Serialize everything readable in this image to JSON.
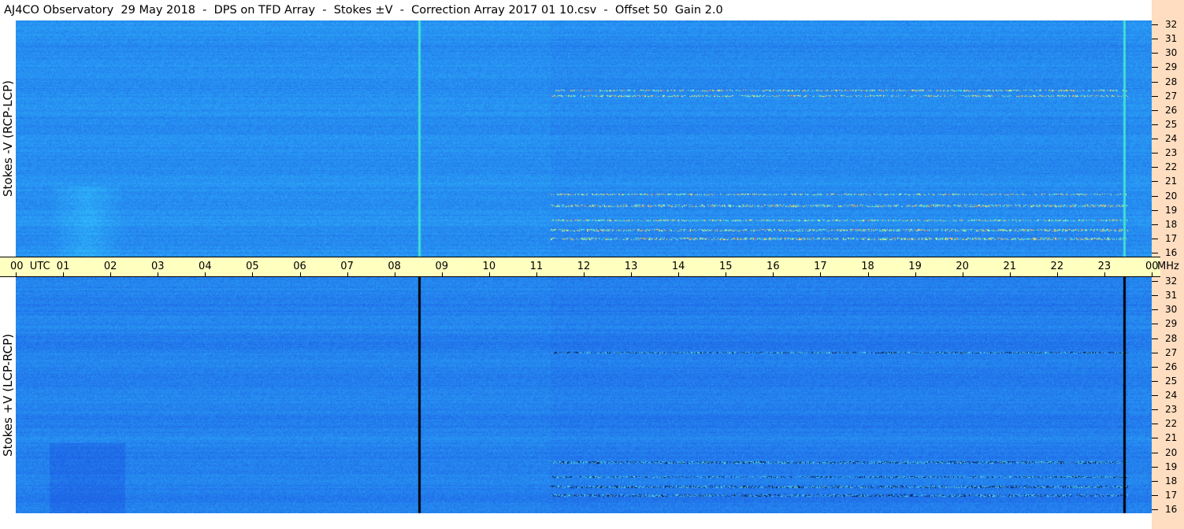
{
  "header": {
    "title": "AJ4CO Observatory  29 May 2018  -  DPS on TFD Array  -  Stokes ±V  -  Correction Array 2017 01 10.csv  -  Offset 50  Gain 2.0"
  },
  "colors": {
    "background": "#ffffff",
    "time_axis_band": "#ffffc0",
    "freq_axis_band": "#ffddc0",
    "spectrogram_base": "#1e64e6",
    "spectrogram_high": "#32c8ff",
    "burst_bright": "#ffff64",
    "burst_hot": "#ff6440",
    "dropout": "#000000"
  },
  "chart_data": {
    "type": "heatmap",
    "title": "AJ4CO Observatory  29 May 2018  -  DPS on TFD Array  -  Stokes ±V  -  Correction Array 2017 01 10.csv  -  Offset 50  Gain 2.0",
    "x": {
      "unit": "UTC",
      "range": [
        0,
        24
      ],
      "tick_labels": [
        "00  UTC",
        "01",
        "02",
        "03",
        "04",
        "05",
        "06",
        "07",
        "08",
        "09",
        "10",
        "11",
        "12",
        "13",
        "14",
        "15",
        "16",
        "17",
        "18",
        "19",
        "20",
        "21",
        "22",
        "23",
        "00"
      ],
      "tick_hours": [
        0,
        1,
        2,
        3,
        4,
        5,
        6,
        7,
        8,
        9,
        10,
        11,
        12,
        13,
        14,
        15,
        16,
        17,
        18,
        19,
        20,
        21,
        22,
        23,
        24
      ]
    },
    "y": {
      "unit": "MHz",
      "range": [
        16,
        32
      ],
      "tick_labels": [
        "16",
        "17",
        "18",
        "19",
        "20",
        "21",
        "22",
        "23",
        "24",
        "25",
        "26",
        "27",
        "28",
        "29",
        "30",
        "31",
        "32"
      ],
      "tick_values": [
        16,
        17,
        18,
        19,
        20,
        21,
        22,
        23,
        24,
        25,
        26,
        27,
        28,
        29,
        30,
        31,
        32
      ]
    },
    "panels": [
      {
        "label": "Stokes -V (RCP-LCP)",
        "features": {
          "vertical_lines_utc": [
            8.5,
            23.4
          ],
          "vertical_line_color": "#40e0d0",
          "burst_activity_utc": [
            11.3,
            23.5
          ],
          "strong_bands_mhz": [
            17.0,
            17.6,
            18.3,
            19.3,
            20.1,
            27.0,
            27.4
          ],
          "early_feature_utc": [
            0.7,
            2.3
          ]
        }
      },
      {
        "label": "Stokes +V (LCP-RCP)",
        "features": {
          "vertical_lines_utc": [
            8.5,
            23.4
          ],
          "vertical_line_color": "#000000",
          "burst_activity_utc": [
            11.3,
            23.5
          ],
          "strong_bands_mhz": [
            17.0,
            17.6,
            18.3,
            19.3,
            27.0
          ],
          "early_feature_utc": [
            0.7,
            2.3
          ]
        }
      }
    ]
  }
}
